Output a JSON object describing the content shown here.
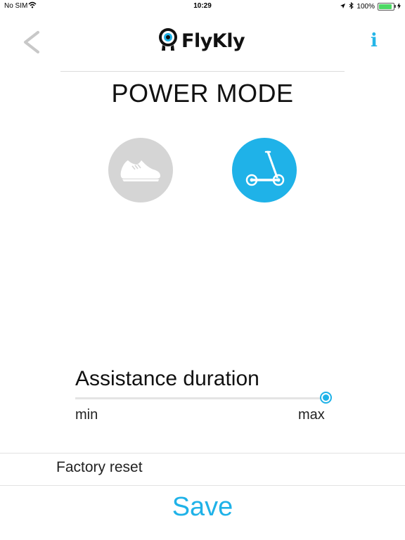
{
  "status_bar": {
    "carrier": "No SIM",
    "time": "10:29",
    "battery": "100%",
    "battery_level": 1.0
  },
  "header": {
    "logo_text": "FlyKly",
    "back_icon": "chevron-left-icon",
    "info_label": "i"
  },
  "page": {
    "title": "POWER MODE"
  },
  "modes": {
    "items": [
      {
        "name": "walk",
        "icon": "sneaker-icon",
        "selected": false
      },
      {
        "name": "scooter",
        "icon": "kick-scooter-icon",
        "selected": true
      }
    ]
  },
  "assistance": {
    "label": "Assistance duration",
    "min_label": "min",
    "max_label": "max",
    "value": 1.0
  },
  "actions": {
    "factory_reset": "Factory reset",
    "save": "Save"
  },
  "colors": {
    "accent": "#1fb2e8",
    "inactive": "#d5d5d5"
  }
}
